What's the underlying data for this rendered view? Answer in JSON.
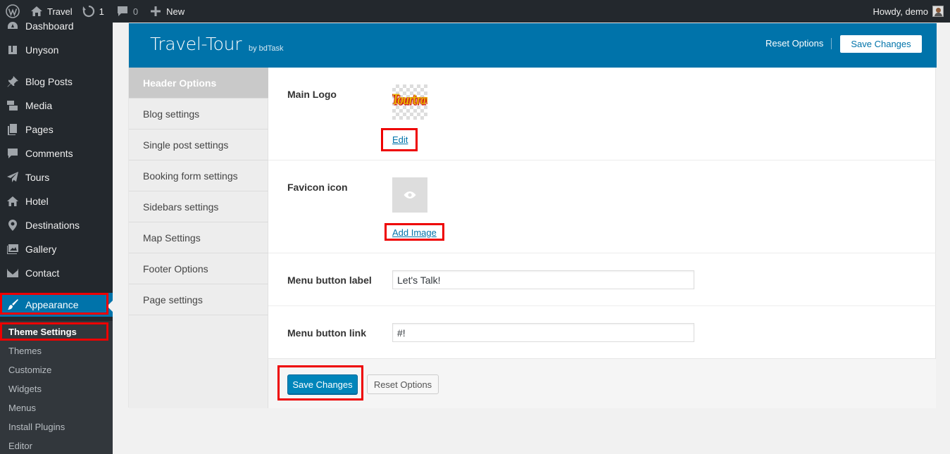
{
  "adminbar": {
    "site_name": "Travel",
    "updates_count": "1",
    "comments_count": "0",
    "new_label": "New",
    "greeting": "Howdy, demo"
  },
  "sidebar": {
    "items": [
      {
        "label": "Dashboard",
        "icon": "dashboard-icon"
      },
      {
        "label": "Unyson",
        "icon": "unyson-icon"
      },
      {
        "label": "Blog Posts",
        "icon": "pin-icon"
      },
      {
        "label": "Media",
        "icon": "media-icon"
      },
      {
        "label": "Pages",
        "icon": "pages-icon"
      },
      {
        "label": "Comments",
        "icon": "comments-icon"
      },
      {
        "label": "Tours",
        "icon": "paper-plane-icon"
      },
      {
        "label": "Hotel",
        "icon": "home-icon"
      },
      {
        "label": "Destinations",
        "icon": "location-pin-icon"
      },
      {
        "label": "Gallery",
        "icon": "gallery-icon"
      },
      {
        "label": "Contact",
        "icon": "mail-icon"
      },
      {
        "label": "Appearance",
        "icon": "paintbrush-icon",
        "active": true
      }
    ],
    "submenu": [
      {
        "label": "Theme Settings",
        "current": true
      },
      {
        "label": "Themes"
      },
      {
        "label": "Customize"
      },
      {
        "label": "Widgets"
      },
      {
        "label": "Menus"
      },
      {
        "label": "Install Plugins"
      },
      {
        "label": "Editor"
      }
    ]
  },
  "panel": {
    "title": "Travel-Tour",
    "byline": "by bdTask",
    "reset_label": "Reset Options",
    "save_label": "Save Changes"
  },
  "tabs": [
    {
      "label": "Header Options",
      "active": true
    },
    {
      "label": "Blog settings"
    },
    {
      "label": "Single post settings"
    },
    {
      "label": "Booking form settings"
    },
    {
      "label": "Sidebars settings"
    },
    {
      "label": "Map Settings"
    },
    {
      "label": "Footer Options"
    },
    {
      "label": "Page settings"
    }
  ],
  "options": {
    "main_logo": {
      "label": "Main Logo",
      "logo_text": "Tourtravel",
      "action": "Edit"
    },
    "favicon": {
      "label": "Favicon icon",
      "action": "Add Image"
    },
    "menu_button_label": {
      "label": "Menu button label",
      "value": "Let's Talk!"
    },
    "menu_button_link": {
      "label": "Menu button link",
      "value": "#!"
    }
  },
  "footer": {
    "save_label": "Save Changes",
    "reset_label": "Reset Options"
  },
  "colors": {
    "admin_dark": "#23282d",
    "accent_blue": "#0073aa",
    "highlight_red": "#e00000"
  }
}
